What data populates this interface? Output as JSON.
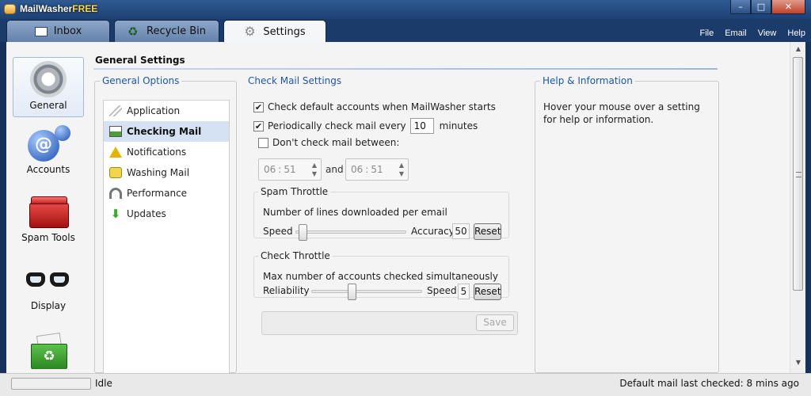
{
  "app": {
    "title": "MailWasher",
    "title_suffix": "FREE",
    "window_buttons": [
      "–",
      "□",
      "✕"
    ]
  },
  "tabs": [
    {
      "label": "Inbox",
      "icon": "mail-icon"
    },
    {
      "label": "Recycle Bin",
      "icon": "recycle-icon"
    },
    {
      "label": "Settings",
      "icon": "gear-icon",
      "active": true
    }
  ],
  "menu": [
    "File",
    "Email",
    "View",
    "Help"
  ],
  "nav": [
    {
      "label": "General",
      "icon": "gear-icon",
      "active": true
    },
    {
      "label": "Accounts",
      "icon": "email-accounts-icon"
    },
    {
      "label": "Spam Tools",
      "icon": "toolbox-icon"
    },
    {
      "label": "Display",
      "icon": "glasses-icon"
    },
    {
      "label": "",
      "icon": "recycle-bin-icon"
    }
  ],
  "page_title": "General Settings",
  "general_options": {
    "legend": "General Options",
    "items": [
      {
        "label": "Application",
        "icon": "application-icon"
      },
      {
        "label": "Checking Mail",
        "icon": "checking-mail-icon",
        "selected": true
      },
      {
        "label": "Notifications",
        "icon": "warning-icon"
      },
      {
        "label": "Washing Mail",
        "icon": "washing-mail-icon"
      },
      {
        "label": "Performance",
        "icon": "performance-icon"
      },
      {
        "label": "Updates",
        "icon": "down-arrow-icon"
      }
    ]
  },
  "check_mail": {
    "legend": "Check Mail Settings",
    "check_default": {
      "label": "Check default accounts when MailWasher starts",
      "checked": true
    },
    "periodic": {
      "label": "Periodically check mail every",
      "value": "10",
      "unit": "minutes",
      "checked": true
    },
    "dont_check": {
      "label": "Don't check mail between:",
      "checked": false
    },
    "time_from": {
      "hour": "06",
      "minute": "51",
      "sep": ":"
    },
    "time_and": "and",
    "time_to": {
      "hour": "06",
      "minute": "51",
      "sep": ":"
    },
    "spam_throttle": {
      "legend": "Spam Throttle",
      "description": "Number of lines downloaded per email",
      "left_label": "Speed",
      "right_label": "Accuracy",
      "value": "50",
      "reset": "Reset"
    },
    "check_throttle": {
      "legend": "Check Throttle",
      "description": "Max number of accounts checked simultaneously",
      "left_label": "Reliability",
      "right_label": "Speed",
      "value": "5",
      "reset": "Reset"
    },
    "save": "Save"
  },
  "help": {
    "legend": "Help & Information",
    "text": "Hover your mouse over a setting for help or information."
  },
  "status": {
    "left": "Idle",
    "right": "Default mail last checked: 8 mins ago"
  },
  "colors": {
    "accent_legend": "#1e56a6",
    "selected_row": "#d4e2f3",
    "titlebar": "#2f5a93"
  }
}
